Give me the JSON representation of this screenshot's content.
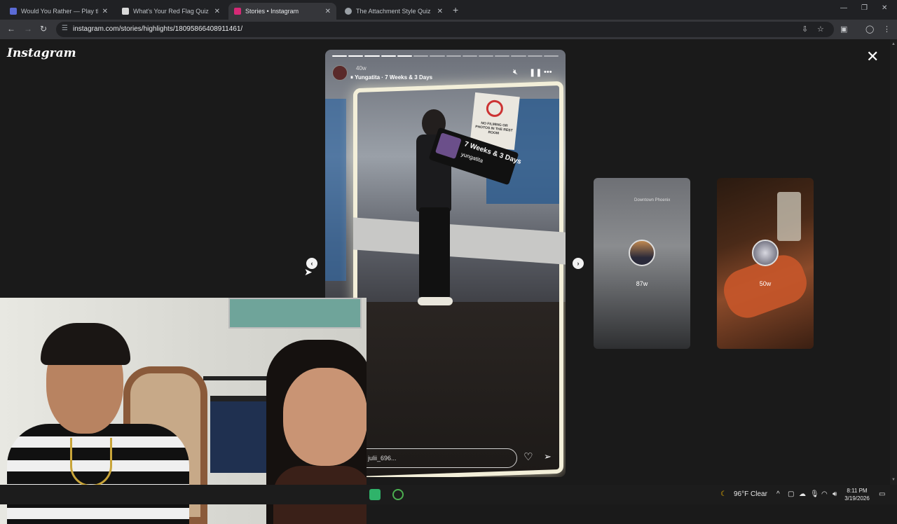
{
  "browser": {
    "tabs": [
      {
        "title": "Would You Rather — Play the C",
        "favicon_color": "#5b6bd6",
        "active": false
      },
      {
        "title": "What's Your Red Flag Quiz - wi",
        "favicon_color": "#d9d9d9",
        "active": false
      },
      {
        "title": "Stories • Instagram",
        "favicon_color": "#d62976",
        "active": true
      },
      {
        "title": "The Attachment Style Quiz",
        "favicon_color": "#9aa0a6",
        "active": false
      }
    ],
    "url": "instagram.com/stories/highlights/18095866408911461/"
  },
  "instagram": {
    "logo": "Instagram",
    "story": {
      "age": "40w",
      "music_line": "Yungatita · 7 Weeks & 3 Days",
      "sticker_big": "7 Weeks & 3 Days",
      "sticker_small": "yungatita",
      "sign_text": "NO FILMING OR PHOTOS IN THE REST ROOM",
      "reply_placeholder": "julii_696...",
      "segments_total": 14,
      "segments_done": 5
    },
    "previews": [
      {
        "age": "87w",
        "location": "Downtown Phoenix"
      },
      {
        "age": "50w"
      }
    ]
  },
  "taskbar": {
    "weather": "96°F  Clear",
    "time": "8:11 PM",
    "date": "3/19/2026"
  },
  "colors": {
    "page_bg": "#1a1a1a",
    "tab_active": "#35363a",
    "titlebar": "#202124"
  }
}
